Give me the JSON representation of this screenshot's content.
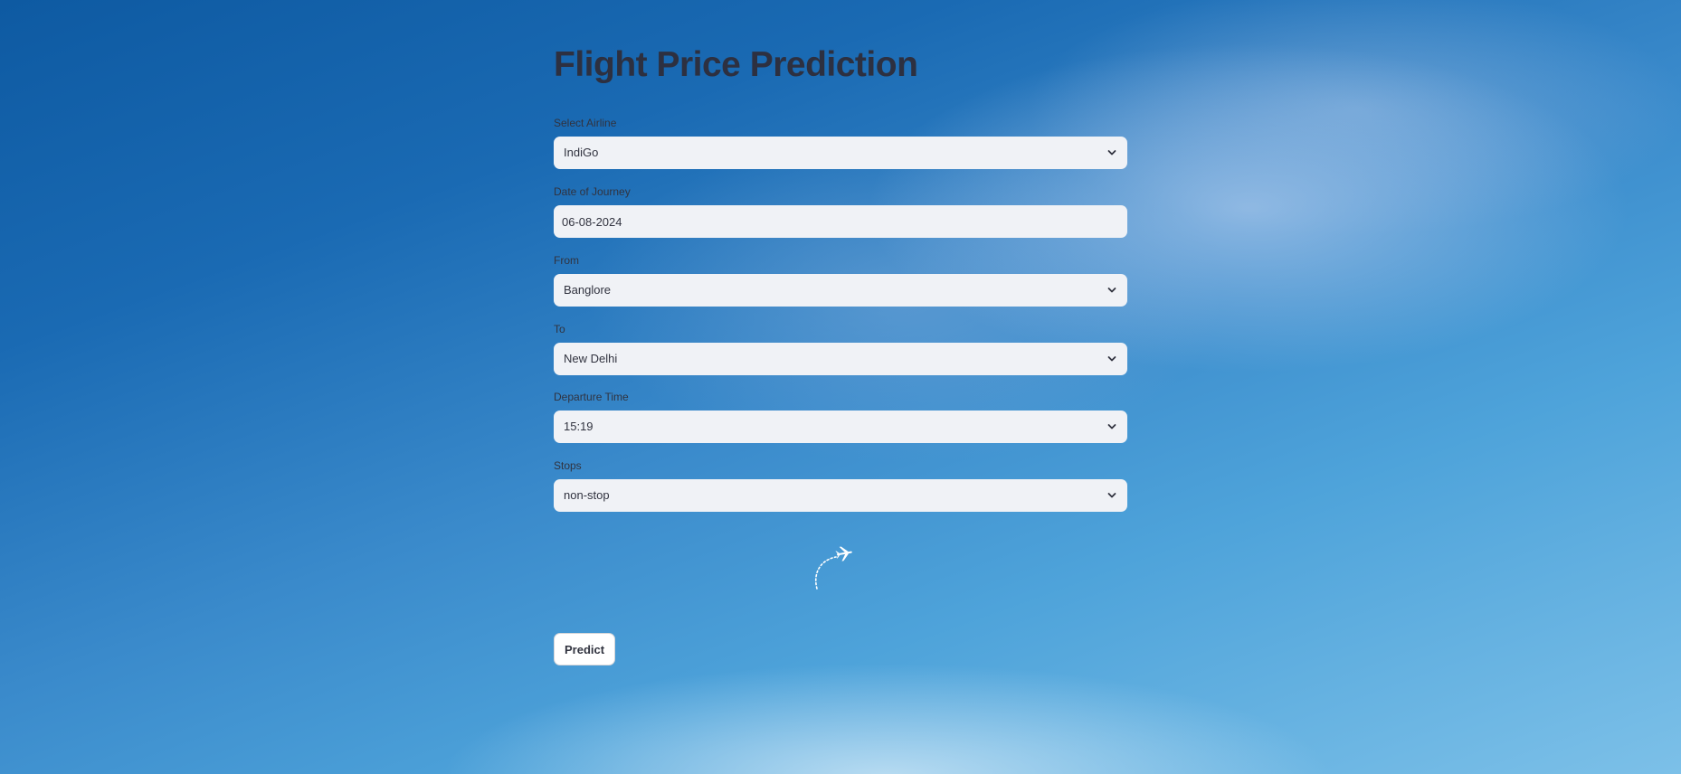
{
  "app": {
    "title": "Flight Price Prediction"
  },
  "form": {
    "airline": {
      "label": "Select Airline",
      "value": "IndiGo"
    },
    "date": {
      "label": "Date of Journey",
      "value": "06-08-2024"
    },
    "from": {
      "label": "From",
      "value": "Banglore"
    },
    "to": {
      "label": "To",
      "value": "New Delhi"
    },
    "departure": {
      "label": "Departure Time",
      "value": "15:19"
    },
    "stops": {
      "label": "Stops",
      "value": "non-stop"
    }
  },
  "actions": {
    "predict_label": "Predict"
  },
  "icons": {
    "dropdown": "chevron-down-icon",
    "loader": "airplane-icon"
  },
  "colors": {
    "field_bg": "#f0f2f6",
    "text": "#31333f",
    "title": "#2d3040"
  }
}
